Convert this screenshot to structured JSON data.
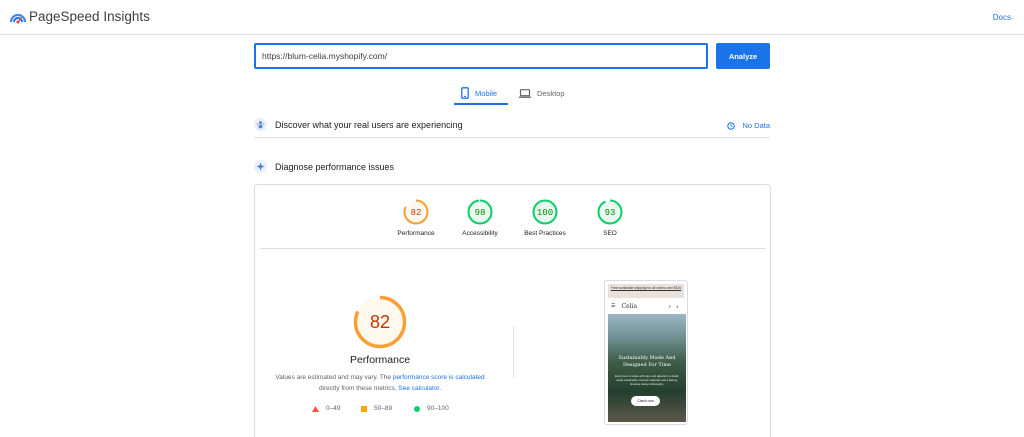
{
  "app": {
    "title": "PageSpeed Insights",
    "docs_label": "Docs",
    "logo_icon": "pagespeed-logo-icon"
  },
  "search": {
    "url": "https://blum-celia.myshopify.com/",
    "analyze_label": "Analyze"
  },
  "tabs": [
    {
      "label": "Mobile",
      "icon": "smartphone-icon",
      "active": true
    },
    {
      "label": "Desktop",
      "icon": "laptop-icon",
      "active": false
    }
  ],
  "real_users": {
    "title": "Discover what your real users are experiencing",
    "status": "No Data",
    "icon": "users-icon",
    "status_icon": "timer-icon"
  },
  "diagnose": {
    "title": "Diagnose performance issues",
    "icon": "lighthouse-icon"
  },
  "scores": [
    {
      "label": "Performance",
      "value": 82,
      "color": "#fa9f32"
    },
    {
      "label": "Accessibility",
      "value": 98,
      "color": "#0cce6b"
    },
    {
      "label": "Best Practices",
      "value": 100,
      "color": "#0cce6b"
    },
    {
      "label": "SEO",
      "value": 93,
      "color": "#0cce6b"
    }
  ],
  "performance": {
    "score": 82,
    "label": "Performance",
    "desc_prefix": "Values are estimated and may vary. The ",
    "desc_link1": "performance score is calculated",
    "desc_middle": " directly from these metrics. ",
    "desc_link2": "See calculator."
  },
  "legend": [
    {
      "range": "0–49",
      "shape": "triangle",
      "color": "#ff4e42"
    },
    {
      "range": "50–89",
      "shape": "square",
      "color": "#ffa400"
    },
    {
      "range": "90–100",
      "shape": "circle",
      "color": "#0cce6b"
    }
  ],
  "screenshot": {
    "banner": "Free worldwide shipping for all orders over $100",
    "brand": "Celia",
    "menu_icon": "☰",
    "actions": "⌕ ◐",
    "hero_title": "Sustainably Made And Designed For Time",
    "hero_body": "Every item is made with care and attention to detail, using sustainably sourced materials and a lasting, timeless design philosophy.",
    "cta": "Check now"
  }
}
